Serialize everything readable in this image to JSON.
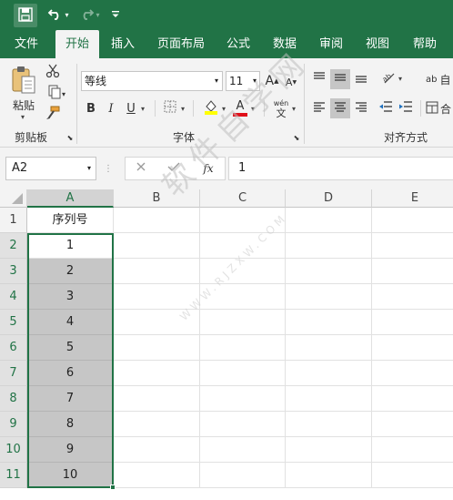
{
  "quick_access": {
    "dropdown_glyph": "▾"
  },
  "tabs": [
    "文件",
    "开始",
    "插入",
    "页面布局",
    "公式",
    "数据",
    "审阅",
    "视图",
    "帮助"
  ],
  "active_tab": "开始",
  "ribbon": {
    "paste_label": "粘贴",
    "groups": {
      "clipboard": "剪贴板",
      "font": "字体",
      "alignment": "对齐方式"
    },
    "font_name": "等线",
    "font_size": "11",
    "font_grow": "A",
    "font_shrink": "A",
    "bold": "B",
    "italic": "I",
    "underline": "U",
    "font_color_letter": "A",
    "phonetic_top": "wén",
    "phonetic_bottom": "文",
    "wrap_partial": "ab",
    "wrap_partial_cn": "自",
    "merge_partial_cn": "合",
    "colors": {
      "fill_color": "#ffff00",
      "font_color": "#e0101a",
      "brand": "#217346"
    }
  },
  "formula_bar": {
    "name_box": "A2",
    "fx_label": "fx",
    "value": "1"
  },
  "columns": [
    "A",
    "B",
    "C",
    "D",
    "E"
  ],
  "rows": [
    "1",
    "2",
    "3",
    "4",
    "5",
    "6",
    "7",
    "8",
    "9",
    "10",
    "11"
  ],
  "cells_A": [
    "序列号",
    "1",
    "2",
    "3",
    "4",
    "5",
    "6",
    "7",
    "8",
    "9",
    "10"
  ],
  "watermark": {
    "main": "软件自学网",
    "sub": "WWW.RJZXW.COM"
  }
}
